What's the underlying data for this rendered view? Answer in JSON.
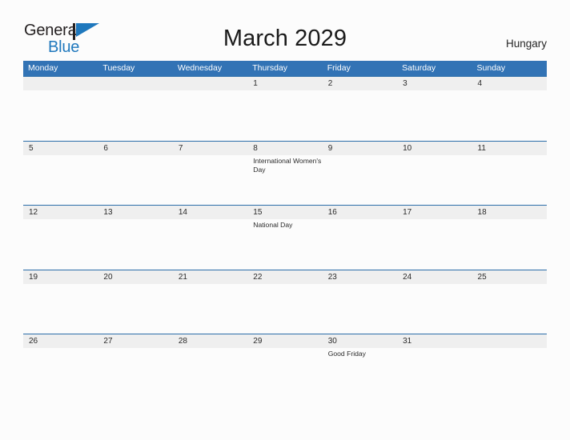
{
  "brand": {
    "name_top": "General",
    "name_bottom": "Blue",
    "flag_color": "#1f78bd",
    "text_color": "#231f20"
  },
  "header": {
    "title": "March 2029",
    "country": "Hungary"
  },
  "theme": {
    "header_blue": "#3273b5",
    "row_border_blue": "#2a6da9",
    "band_gray": "#efefef",
    "page_background": "#fcfcfc"
  },
  "calendar": {
    "month": "March",
    "year": "2029",
    "weekday_headers": [
      "Monday",
      "Tuesday",
      "Wednesday",
      "Thursday",
      "Friday",
      "Saturday",
      "Sunday"
    ],
    "weeks": [
      [
        {
          "day": "",
          "event": ""
        },
        {
          "day": "",
          "event": ""
        },
        {
          "day": "",
          "event": ""
        },
        {
          "day": "1",
          "event": ""
        },
        {
          "day": "2",
          "event": ""
        },
        {
          "day": "3",
          "event": ""
        },
        {
          "day": "4",
          "event": ""
        }
      ],
      [
        {
          "day": "5",
          "event": ""
        },
        {
          "day": "6",
          "event": ""
        },
        {
          "day": "7",
          "event": ""
        },
        {
          "day": "8",
          "event": "International Women's Day"
        },
        {
          "day": "9",
          "event": ""
        },
        {
          "day": "10",
          "event": ""
        },
        {
          "day": "11",
          "event": ""
        }
      ],
      [
        {
          "day": "12",
          "event": ""
        },
        {
          "day": "13",
          "event": ""
        },
        {
          "day": "14",
          "event": ""
        },
        {
          "day": "15",
          "event": "National Day"
        },
        {
          "day": "16",
          "event": ""
        },
        {
          "day": "17",
          "event": ""
        },
        {
          "day": "18",
          "event": ""
        }
      ],
      [
        {
          "day": "19",
          "event": ""
        },
        {
          "day": "20",
          "event": ""
        },
        {
          "day": "21",
          "event": ""
        },
        {
          "day": "22",
          "event": ""
        },
        {
          "day": "23",
          "event": ""
        },
        {
          "day": "24",
          "event": ""
        },
        {
          "day": "25",
          "event": ""
        }
      ],
      [
        {
          "day": "26",
          "event": ""
        },
        {
          "day": "27",
          "event": ""
        },
        {
          "day": "28",
          "event": ""
        },
        {
          "day": "29",
          "event": ""
        },
        {
          "day": "30",
          "event": "Good Friday"
        },
        {
          "day": "31",
          "event": ""
        },
        {
          "day": "",
          "event": ""
        }
      ]
    ]
  }
}
